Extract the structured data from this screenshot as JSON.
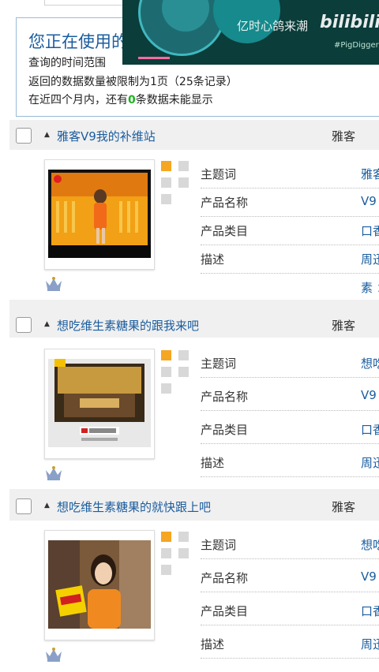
{
  "notice": {
    "title": "您正在使用的",
    "line1": "查询的时间范围",
    "line2": "返回的数据数量被限制为1页（25条记录）",
    "line3_prefix": "在近四个月内，还有",
    "line3_count": "0",
    "line3_suffix": "条数据未能显示"
  },
  "overlay": {
    "watermark": "亿时心鸽来潮",
    "logo": "bilibili",
    "handle": "#PigDigger"
  },
  "labels": {
    "keyword": "主题词",
    "product_name": "产品名称",
    "product_category": "产品类目",
    "description": "描述"
  },
  "items": [
    {
      "title": "雅客V9我的补维站",
      "brand": "雅客",
      "keyword": "雅客",
      "product_name": "V9",
      "product_category": "口香",
      "description": "周迅",
      "extra": "素 ："
    },
    {
      "title": "想吃维生素糖果的跟我来吧",
      "brand": "雅客",
      "keyword": "想吃",
      "product_name": "V9",
      "product_category": "口香",
      "description": "周迅"
    },
    {
      "title": "想吃维生素糖果的就快跟上吧",
      "brand": "雅客",
      "keyword": "想吃",
      "product_name": "V9",
      "product_category": "口香",
      "description": "周迅"
    }
  ],
  "colors": {
    "link": "#1a5c9e",
    "accent_green": "#1db31d",
    "dot_orange": "#f5a623",
    "section_bg": "#f0f0f0"
  }
}
